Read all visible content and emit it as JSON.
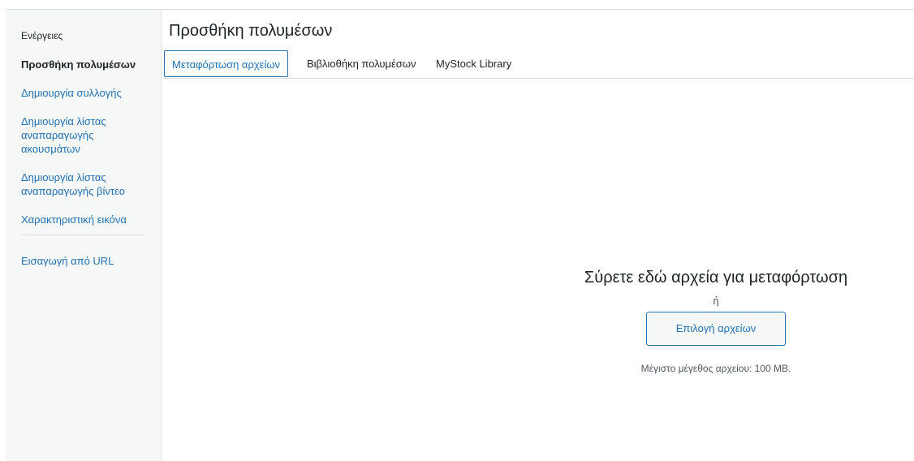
{
  "sidebar": {
    "heading": "Ενέργειες",
    "items": [
      {
        "label": "Προσθήκη πολυμέσων",
        "active": true
      },
      {
        "label": "Δημιουργία συλλογής",
        "active": false
      },
      {
        "label": "Δημιουργία λίστας αναπαραγωγής ακουσμάτων",
        "active": false
      },
      {
        "label": "Δημιουργία λίστας αναπαραγωγής βίντεο",
        "active": false
      },
      {
        "label": "Χαρακτηριστική εικόνα",
        "active": false
      }
    ],
    "extra_item": "Εισαγωγή από URL"
  },
  "main": {
    "title": "Προσθήκη πολυμέσων",
    "tabs": [
      {
        "label": "Μεταφόρτωση αρχείων",
        "active": true
      },
      {
        "label": "Βιβλιοθήκη πολυμέσων",
        "active": false
      },
      {
        "label": "MyStock Library",
        "active": false
      }
    ]
  },
  "upload": {
    "drop_text": "Σύρετε εδώ αρχεία για μεταφόρτωση",
    "or_text": "ή",
    "select_button": "Επιλογή αρχείων",
    "max_size": "Μέγιστο μέγεθος αρχείου: 100 MB."
  },
  "colors": {
    "link": "#2271b1",
    "text": "#1d2327",
    "sidebar_bg": "#f6f7f7",
    "border": "#dcdcde"
  }
}
